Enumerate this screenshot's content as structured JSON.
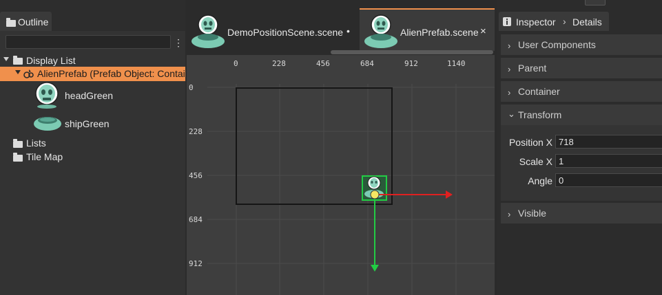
{
  "outline": {
    "tab_label": "Outline",
    "filter_value": "",
    "tree": {
      "display_list": "Display List",
      "prefab": "AlienPrefab (Prefab Object: Contai",
      "children": [
        "headGreen",
        "shipGreen"
      ],
      "lists": "Lists",
      "tile_map": "Tile Map"
    }
  },
  "editor": {
    "tabs": [
      {
        "label": "DemoPositionScene.scene",
        "modified_mark": "•"
      },
      {
        "label": "AlienPrefab.scene",
        "close": "×"
      }
    ]
  },
  "scene": {
    "ruler_x": [
      "0",
      "228",
      "456",
      "684",
      "912",
      "1140"
    ],
    "ruler_y": [
      "0",
      "228",
      "456",
      "684",
      "912"
    ]
  },
  "inspector": {
    "tab_label": "Inspector",
    "breadcrumb": "Details",
    "sections": {
      "user_components": "User Components",
      "parent": "Parent",
      "container": "Container",
      "transform": "Transform",
      "visible": "Visible"
    },
    "transform": {
      "position_x_label": "Position X",
      "position_x_value": "718",
      "scale_x_label": "Scale X",
      "scale_x_value": "1",
      "angle_label": "Angle",
      "angle_value": "0"
    }
  },
  "colors": {
    "accent": "#f0904c",
    "alien_green": "#8fd4bf",
    "gizmo_x": "#e02020",
    "gizmo_y": "#22cc44",
    "gizmo_center": "#f5e663"
  }
}
